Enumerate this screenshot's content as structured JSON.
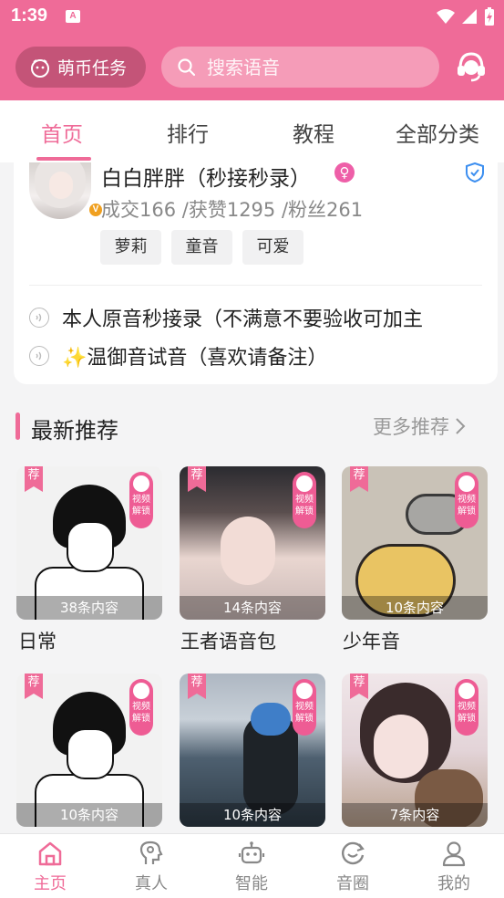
{
  "status_bar": {
    "time": "1:39",
    "notif_glyph": "A"
  },
  "header": {
    "coin_task_label": "萌币任务",
    "search_placeholder": "搜索语音",
    "service_icon": "headset-icon"
  },
  "tabs": [
    {
      "label": "首页",
      "active": true
    },
    {
      "label": "排行",
      "active": false
    },
    {
      "label": "教程",
      "active": false
    },
    {
      "label": "全部分类",
      "active": false
    }
  ],
  "profile": {
    "name": "白白胖胖（秒接秒录）",
    "gender_symbol": "♀",
    "stats": "成交166 /获赞1295 /粉丝261",
    "vip_badge": "V",
    "tags": [
      "萝莉",
      "童音",
      "可爱"
    ],
    "voice_lines": [
      "本人原音秒接录（不满意不要验收可加主",
      "✨温御音试音（喜欢请备注）"
    ]
  },
  "section": {
    "title": "最新推荐",
    "more_label": "更多推荐"
  },
  "grid": [
    {
      "badge": "荐",
      "lock_text": "视频解锁",
      "count": "38条内容",
      "title": "日常"
    },
    {
      "badge": "荐",
      "lock_text": "视频解锁",
      "count": "14条内容",
      "title": "王者语音包"
    },
    {
      "badge": "荐",
      "lock_text": "视频解锁",
      "count": "10条内容",
      "title": "少年音"
    },
    {
      "badge": "荐",
      "lock_text": "视频解锁",
      "count": "10条内容",
      "title": ""
    },
    {
      "badge": "荐",
      "lock_text": "视频解锁",
      "count": "10条内容",
      "title": ""
    },
    {
      "badge": "荐",
      "lock_text": "视频解锁",
      "count": "7条内容",
      "title": ""
    }
  ],
  "bottom_nav": [
    {
      "label": "主页",
      "icon": "home-icon",
      "active": true
    },
    {
      "label": "真人",
      "icon": "person-voice-icon",
      "active": false
    },
    {
      "label": "智能",
      "icon": "robot-icon",
      "active": false
    },
    {
      "label": "音圈",
      "icon": "circle-refresh-icon",
      "active": false
    },
    {
      "label": "我的",
      "icon": "user-icon",
      "active": false
    }
  ],
  "colors": {
    "accent": "#ef6b98",
    "dark_pink": "#c45478",
    "search_bg": "#f59cb8"
  }
}
